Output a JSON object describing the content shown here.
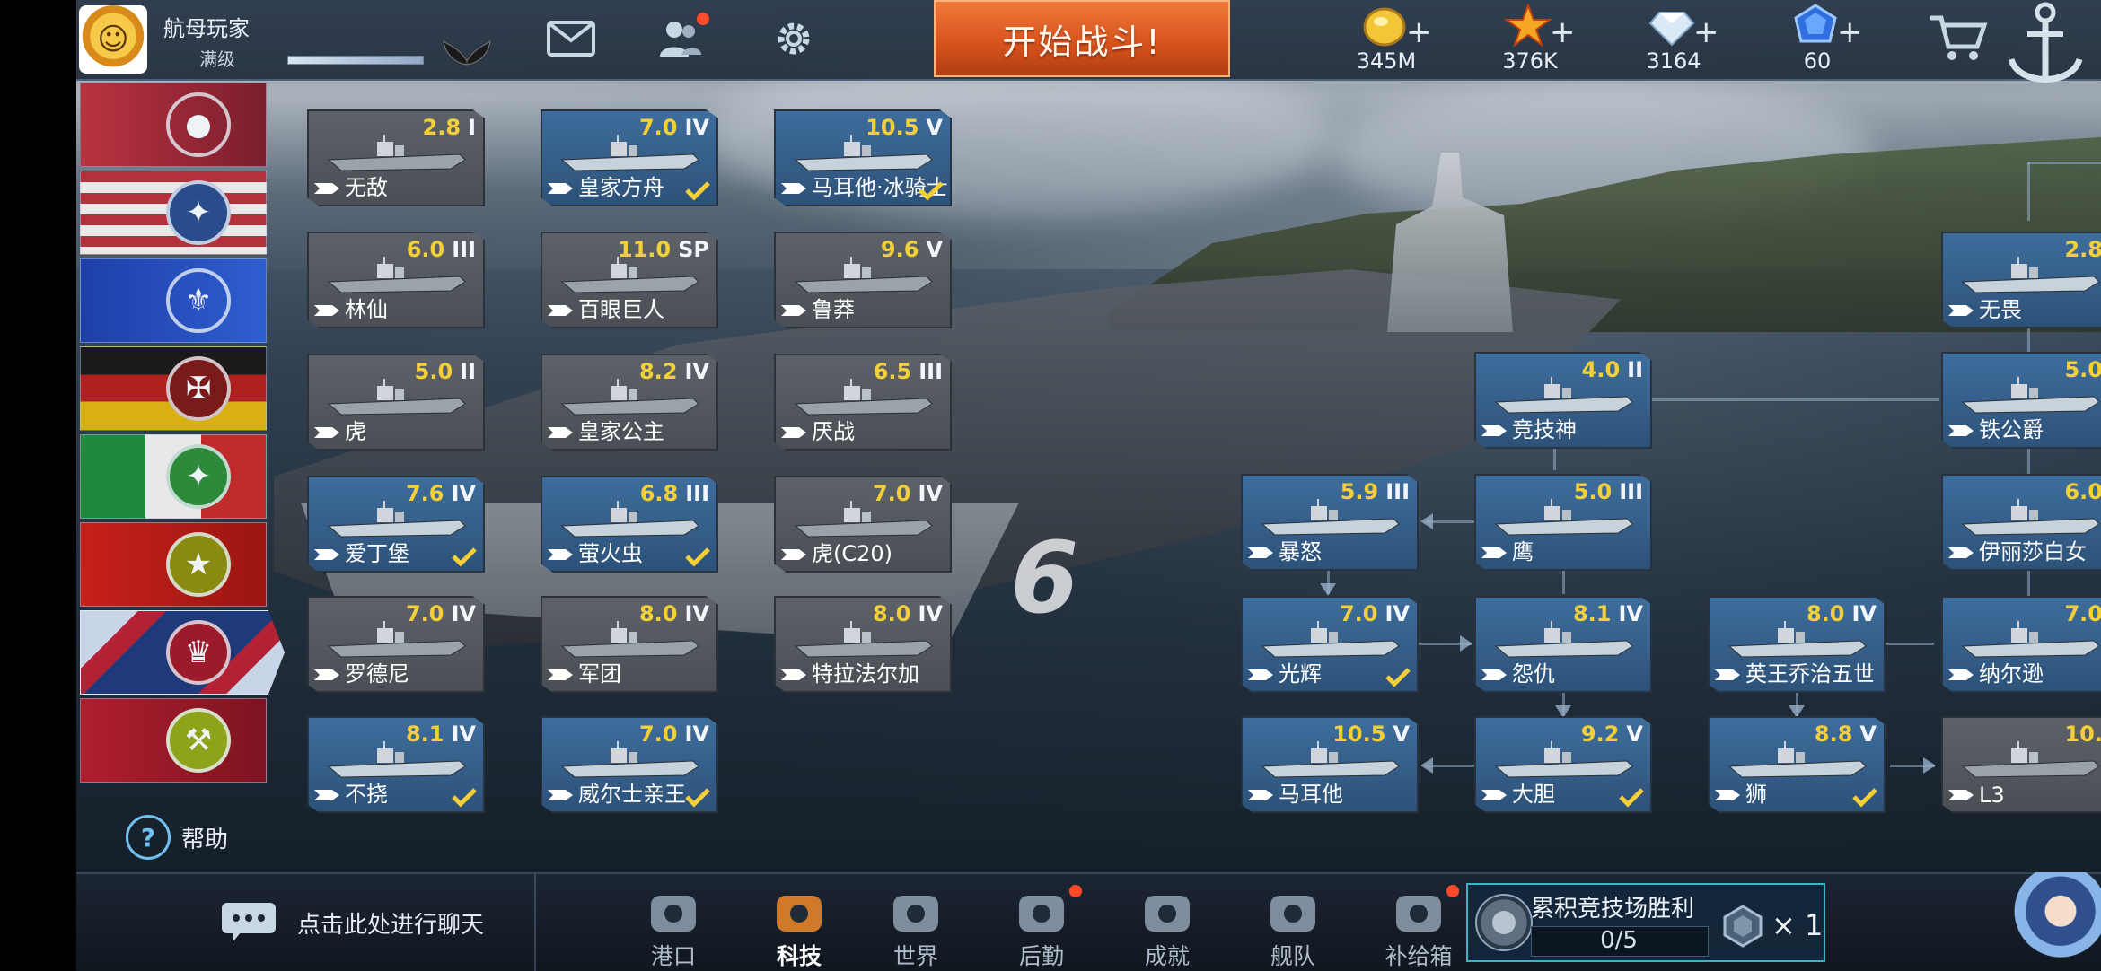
{
  "player": {
    "name": "航母玩家",
    "level": "满级",
    "exp_fraction": 1.0
  },
  "top_actions": {
    "start_battle": "开始战斗!"
  },
  "currencies": [
    {
      "icon": "gold-coin-icon",
      "value": "345M",
      "plus": "+"
    },
    {
      "icon": "star-icon",
      "value": "376K",
      "plus": "+"
    },
    {
      "icon": "diamond-icon",
      "value": "3164",
      "plus": "+"
    },
    {
      "icon": "blue-gem-icon",
      "value": "60",
      "plus": "+"
    }
  ],
  "help_label": "帮助",
  "ship_cards": [
    {
      "name": "无敌",
      "rating": "2.8",
      "tier": "I",
      "style": "grey",
      "check": false
    },
    {
      "name": "皇家方舟",
      "rating": "7.0",
      "tier": "IV",
      "style": "blue",
      "check": true
    },
    {
      "name": "马耳他·冰骑士",
      "rating": "10.5",
      "tier": "V",
      "style": "blue",
      "check": true
    },
    {
      "name": "林仙",
      "rating": "6.0",
      "tier": "III",
      "style": "grey",
      "check": false
    },
    {
      "name": "百眼巨人",
      "rating": "11.0",
      "tier": "SP",
      "style": "grey",
      "check": false
    },
    {
      "name": "鲁莽",
      "rating": "9.6",
      "tier": "V",
      "style": "grey",
      "check": false
    },
    {
      "name": "虎",
      "rating": "5.0",
      "tier": "II",
      "style": "grey",
      "check": false
    },
    {
      "name": "皇家公主",
      "rating": "8.2",
      "tier": "IV",
      "style": "grey",
      "check": false
    },
    {
      "name": "厌战",
      "rating": "6.5",
      "tier": "III",
      "style": "grey",
      "check": false
    },
    {
      "name": "爱丁堡",
      "rating": "7.6",
      "tier": "IV",
      "style": "blue",
      "check": true
    },
    {
      "name": "萤火虫",
      "rating": "6.8",
      "tier": "III",
      "style": "blue",
      "check": true
    },
    {
      "name": "虎(C20)",
      "rating": "7.0",
      "tier": "IV",
      "style": "grey",
      "check": false
    },
    {
      "name": "罗德尼",
      "rating": "7.0",
      "tier": "IV",
      "style": "grey",
      "check": false
    },
    {
      "name": "军团",
      "rating": "8.0",
      "tier": "IV",
      "style": "grey",
      "check": false
    },
    {
      "name": "特拉法尔加",
      "rating": "8.0",
      "tier": "IV",
      "style": "grey",
      "check": false
    },
    {
      "name": "不挠",
      "rating": "8.1",
      "tier": "IV",
      "style": "blue",
      "check": true
    },
    {
      "name": "威尔士亲王",
      "rating": "7.0",
      "tier": "IV",
      "style": "blue",
      "check": true
    },
    {
      "name": "竞技神",
      "rating": "4.0",
      "tier": "II",
      "style": "blue",
      "check": false
    },
    {
      "name": "暴怒",
      "rating": "5.9",
      "tier": "III",
      "style": "blue",
      "check": false
    },
    {
      "name": "鹰",
      "rating": "5.0",
      "tier": "III",
      "style": "blue",
      "check": false
    },
    {
      "name": "光辉",
      "rating": "7.0",
      "tier": "IV",
      "style": "blue",
      "check": true
    },
    {
      "name": "怨仇",
      "rating": "8.1",
      "tier": "IV",
      "style": "blue",
      "check": false
    },
    {
      "name": "英王乔治五世",
      "rating": "8.0",
      "tier": "IV",
      "style": "blue",
      "check": false
    },
    {
      "name": "马耳他",
      "rating": "10.5",
      "tier": "V",
      "style": "blue",
      "check": false
    },
    {
      "name": "大胆",
      "rating": "9.2",
      "tier": "V",
      "style": "blue",
      "check": true
    },
    {
      "name": "狮",
      "rating": "8.8",
      "tier": "V",
      "style": "blue",
      "check": true
    },
    {
      "name": "无畏",
      "rating": "2.8",
      "tier": "",
      "style": "blue",
      "check": false
    },
    {
      "name": "铁公爵",
      "rating": "5.0",
      "tier": "",
      "style": "blue",
      "check": false
    },
    {
      "name": "伊丽莎白女",
      "rating": "6.0",
      "tier": "",
      "style": "blue",
      "check": false
    },
    {
      "name": "纳尔逊",
      "rating": "7.0",
      "tier": "",
      "style": "blue",
      "check": false
    },
    {
      "name": "L3",
      "rating": "10.",
      "tier": "",
      "style": "grey",
      "check": false
    }
  ],
  "chat": {
    "placeholder": "点击此处进行聊天"
  },
  "nav": [
    {
      "label": "港口",
      "icon": "port-icon",
      "badge": false,
      "active": false
    },
    {
      "label": "科技",
      "icon": "tech-icon",
      "badge": false,
      "active": true
    },
    {
      "label": "世界",
      "icon": "globe-icon",
      "badge": false,
      "active": false
    },
    {
      "label": "后勤",
      "icon": "logistics-icon",
      "badge": true,
      "active": false
    },
    {
      "label": "成就",
      "icon": "achievement-icon",
      "badge": false,
      "active": false
    },
    {
      "label": "舰队",
      "icon": "fleet-icon",
      "badge": false,
      "active": false
    },
    {
      "label": "补给箱",
      "icon": "supply-box-icon",
      "badge": true,
      "active": false
    }
  ],
  "arena": {
    "title": "累积竞技场胜利",
    "progress": "0/5",
    "reward_count": "× 1"
  },
  "colors": {
    "start_battle": "#d9531d",
    "rating": "#f3cf38",
    "card_blue": "#3e6d9c",
    "card_grey": "#4a4f55",
    "badge_red": "#ff4b2b"
  },
  "nations": [
    "japan",
    "usa",
    "france",
    "germany",
    "italy",
    "china",
    "uk",
    "soviet"
  ]
}
